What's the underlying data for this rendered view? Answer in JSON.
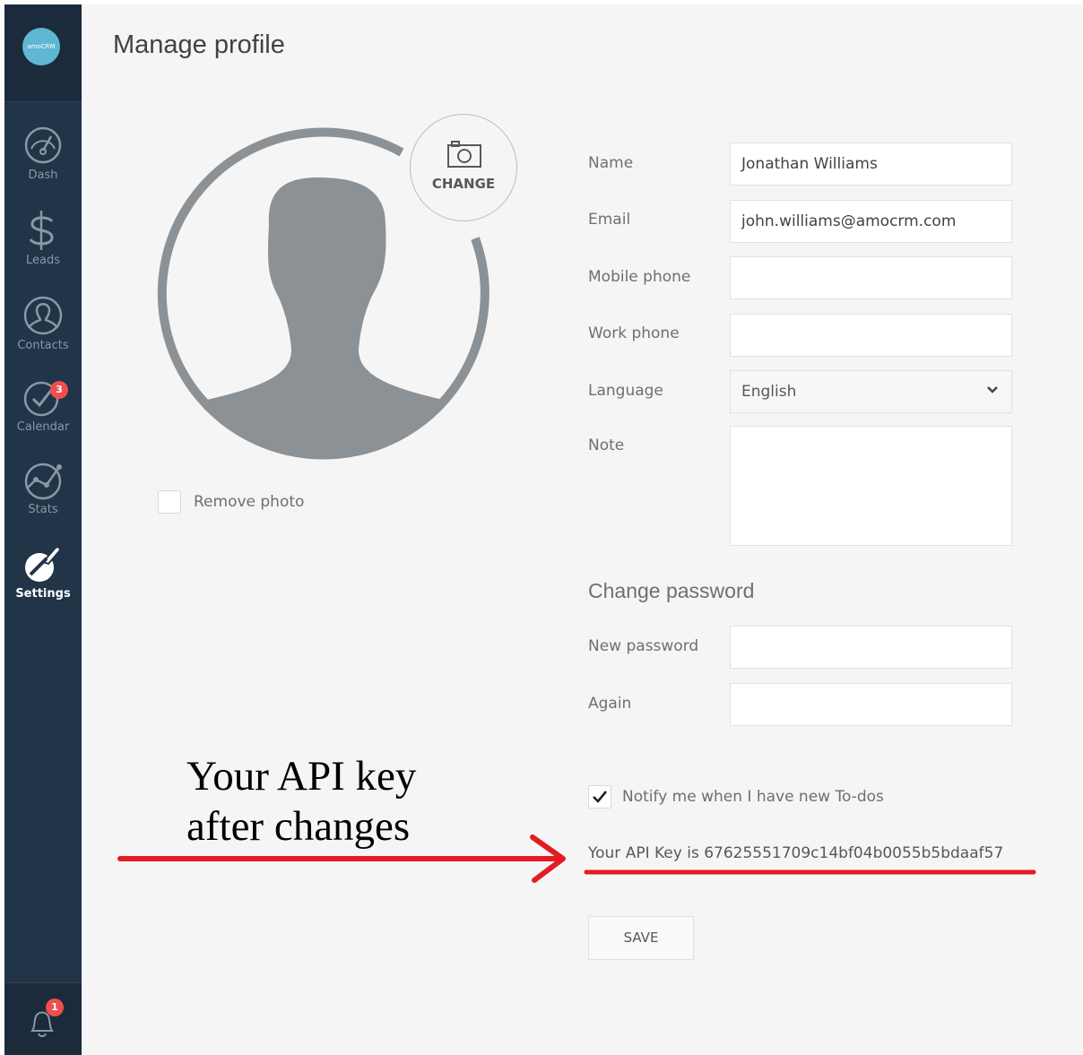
{
  "page": {
    "title": "Manage profile"
  },
  "sidebar": {
    "logo_text": "amoCRM",
    "items": [
      {
        "label": "Dash",
        "icon": "speedometer-icon"
      },
      {
        "label": "Leads",
        "icon": "dollar-icon"
      },
      {
        "label": "Contacts",
        "icon": "person-icon"
      },
      {
        "label": "Calendar",
        "icon": "check-circle-icon",
        "badge": "3"
      },
      {
        "label": "Stats",
        "icon": "chart-icon"
      },
      {
        "label": "Settings",
        "icon": "wrench-icon",
        "active": true
      }
    ],
    "notifications": {
      "icon": "bell-icon",
      "badge": "1"
    }
  },
  "avatar": {
    "change_label": "CHANGE",
    "remove_photo_label": "Remove photo",
    "remove_photo_checked": false
  },
  "form": {
    "name": {
      "label": "Name",
      "value": "Jonathan Williams"
    },
    "email": {
      "label": "Email",
      "value": "john.williams@amocrm.com"
    },
    "mobile_phone": {
      "label": "Mobile phone",
      "value": ""
    },
    "work_phone": {
      "label": "Work phone",
      "value": ""
    },
    "language": {
      "label": "Language",
      "value": "English"
    },
    "note": {
      "label": "Note",
      "value": ""
    }
  },
  "password": {
    "section_title": "Change password",
    "new_label": "New password",
    "again_label": "Again"
  },
  "notify": {
    "label": "Notify me when I have new To-dos",
    "checked": true
  },
  "api_key_text": "Your API Key is 67625551709c14bf04b0055b5bdaaf57",
  "save_label": "SAVE",
  "annotation": {
    "line1": "Your API key",
    "line2": "after changes",
    "color": "#e11d23"
  },
  "colors": {
    "sidebar": "#213448",
    "accent": "#5fb7d3",
    "badge": "#f14e4e"
  }
}
